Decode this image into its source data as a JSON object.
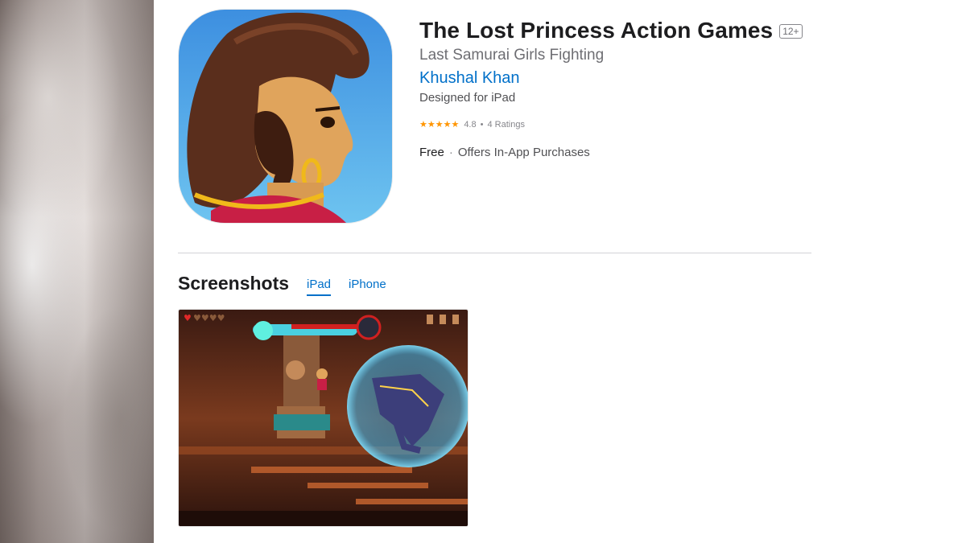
{
  "app": {
    "title": "The Lost Princess Action Games",
    "age_rating": "12+",
    "subtitle": "Last Samurai Girls Fighting",
    "developer": "Khushal Khan",
    "designed_for": "Designed for iPad",
    "rating": {
      "stars_text": "★★★★★",
      "value": "4.8",
      "separator": "•",
      "count": "4 Ratings"
    },
    "price": "Free",
    "price_separator": "·",
    "in_app": "Offers In-App Purchases",
    "icon": "app-icon-princess"
  },
  "screenshots": {
    "title": "Screenshots",
    "tabs": [
      {
        "label": "iPad",
        "selected": true
      },
      {
        "label": "iPhone",
        "selected": false
      }
    ],
    "image": "game-screenshot"
  },
  "colors": {
    "link": "#0070c9",
    "stars": "#ff9500",
    "title": "#1d1d1f"
  }
}
